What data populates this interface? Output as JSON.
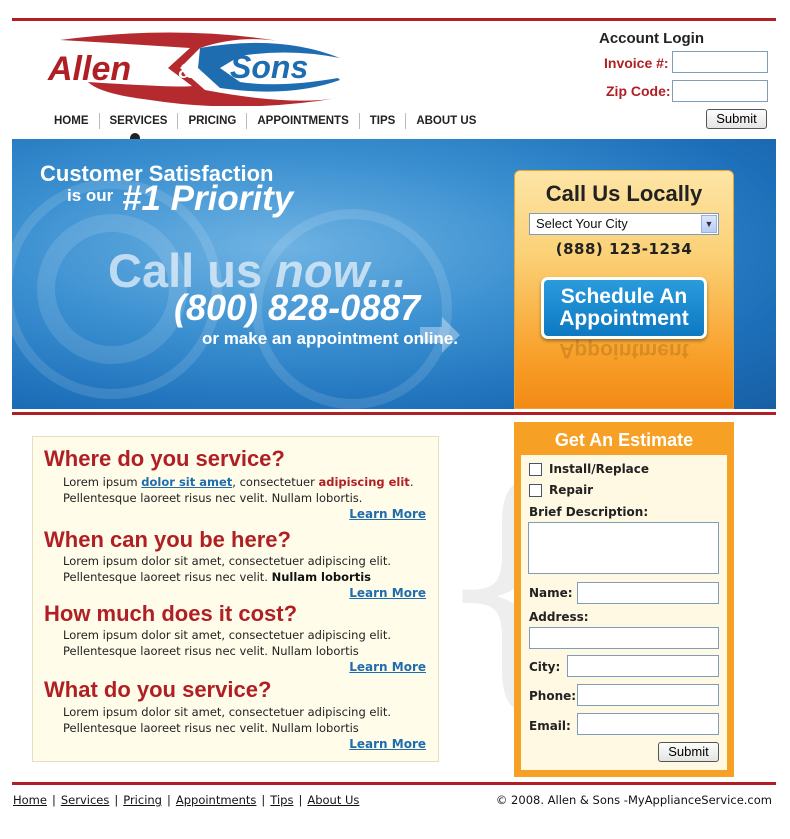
{
  "brand": {
    "logo_left": "Allen",
    "logo_amp": "&",
    "logo_right": "Sons",
    "color_red": "#b01f24",
    "color_blue": "#1f6db1"
  },
  "login": {
    "title": "Account Login",
    "invoice_label": "Invoice #:",
    "zip_label": "Zip Code:",
    "invoice_value": "",
    "zip_value": "",
    "submit": "Submit"
  },
  "nav": {
    "items": [
      "HOME",
      "SERVICES",
      "PRICING",
      "APPOINTMENTS",
      "TIPS",
      "ABOUT US"
    ],
    "active": "SERVICES"
  },
  "banner": {
    "line1": "Customer Satisfaction",
    "line2": "is our",
    "line3": "#1 Priority",
    "call_a": "Call us ",
    "call_b": "now...",
    "phone": "(800) 828-0887",
    "sub": "or make an appointment online."
  },
  "callbox": {
    "title": "Call Us Locally",
    "city_select": "Select Your City",
    "phone": "(888) 123-1234",
    "schedule_line1": "Schedule An",
    "schedule_line2": "Appointment"
  },
  "sections": [
    {
      "title": "Where do you service?",
      "l1_a": "Lorem ipsum ",
      "l1_link": "dolor sit amet",
      "l1_b": ", consectetuer ",
      "l1_red": "adipiscing elit",
      "l1_c": ".",
      "l2": "Pellentesque laoreet risus nec velit. Nullam lobortis.",
      "learn": "Learn More"
    },
    {
      "title": "When can you be here?",
      "l1": "Lorem ipsum dolor sit amet, consectetuer adipiscing elit.",
      "l2_a": "Pellentesque laoreet risus nec velit. ",
      "l2_bold": "Nullam lobortis",
      "learn": "Learn More"
    },
    {
      "title": "How much does it cost?",
      "l1": "Lorem ipsum dolor sit amet, consectetuer adipiscing elit.",
      "l2": "Pellentesque laoreet risus nec velit. Nullam lobortis",
      "learn": "Learn More"
    },
    {
      "title": "What do you service?",
      "l1": "Lorem ipsum dolor sit amet, consectetuer adipiscing elit.",
      "l2": "Pellentesque laoreet risus nec velit. Nullam lobortis",
      "learn": "Learn More"
    }
  ],
  "estimate": {
    "title": "Get An Estimate",
    "opt1": "Install/Replace",
    "opt2": "Repair",
    "desc_label": "Brief Description:",
    "name_label": "Name:",
    "address_label": "Address:",
    "city_label": "City:",
    "phone_label": "Phone:",
    "email_label": "Email:",
    "submit": "Submit"
  },
  "footer": {
    "links": [
      "Home",
      "Services",
      "Pricing",
      "Appointments",
      "Tips",
      "About Us"
    ],
    "separator": "|",
    "copyright": "© 2008. Allen & Sons -MyApplianceService.com"
  }
}
